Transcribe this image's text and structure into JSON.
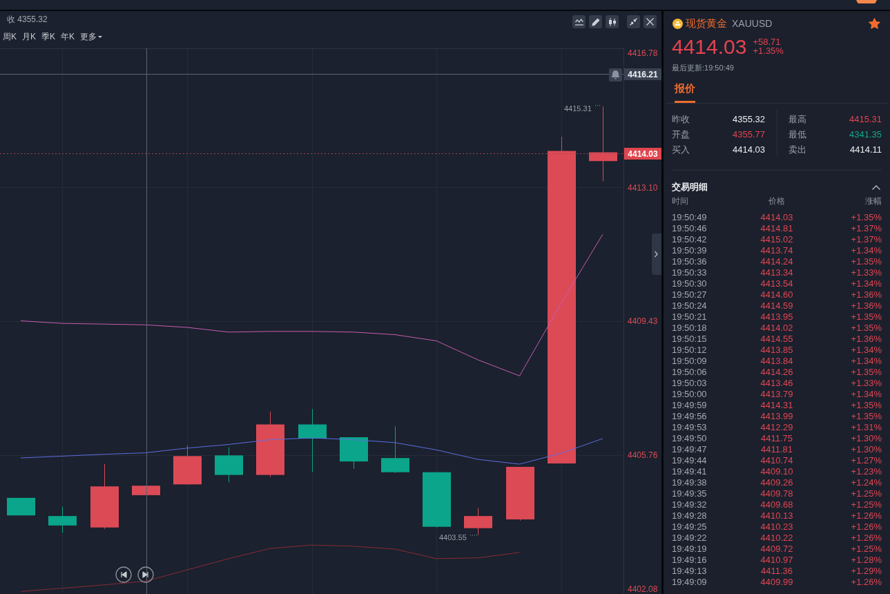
{
  "chart": {
    "previous_close": "收 4355.32",
    "periods": [
      {
        "label": "周K",
        "selected": false
      },
      {
        "label": "月K",
        "selected": false
      },
      {
        "label": "季K",
        "selected": false
      },
      {
        "label": "年K",
        "selected": false
      }
    ],
    "more": "更多",
    "crosshair_price": "4416.21",
    "last_price": "4414.03",
    "high_label": "4415.31",
    "low_label": "4403.55",
    "chart_data": {
      "type": "line",
      "grid": true,
      "categories": [
        null,
        null,
        null,
        null,
        null,
        null,
        null,
        null,
        null,
        null,
        null,
        null,
        null,
        null,
        null
      ],
      "ylim": [
        4401.95,
        4416.91
      ],
      "yticks": [
        4416.78,
        {
          "value": 4413.1,
          "label": "4413.10"
        },
        4409.43,
        4405.76,
        4402.08
      ],
      "ref_lines": [
        {
          "axis": "y",
          "value": 4416.21,
          "color": "#5d6372"
        },
        {
          "axis": "y",
          "value": 4414.03,
          "color": "#a8434e"
        }
      ],
      "series": [
        {
          "color": "#c95bb2",
          "values": [
            4409.44,
            4409.37,
            4409.35,
            4409.33,
            4409.26,
            4409.13,
            4409.15,
            4409.15,
            4409.13,
            4409.06,
            4408.89,
            4408.37,
            4407.93,
            4409.92,
            4411.81
          ]
        },
        {
          "color": "#5b6ee0",
          "values": [
            4405.68,
            4405.73,
            4405.78,
            4405.82,
            4405.95,
            4406.05,
            4406.18,
            4406.23,
            4406.18,
            4406.1,
            4405.9,
            4405.64,
            4405.51,
            4405.81,
            4406.21
          ]
        },
        {
          "color": "#8a2a36",
          "values": [
            4402.02,
            4402.11,
            4402.2,
            4402.3,
            4402.61,
            4402.92,
            4403.2,
            4403.29,
            4403.26,
            4403.18,
            4402.92,
            4402.94,
            4403.09,
            null,
            null
          ]
        }
      ]
    }
  },
  "quote": {
    "name": "现货黄金",
    "symbol": "XAUUSD",
    "favorite": true,
    "price": "4414.03",
    "change": "+58.71",
    "change_percent": "+1.35%",
    "updated": "最后更新:19:50:49",
    "tabs": [
      {
        "label": "报价",
        "selected": true
      }
    ],
    "stats": [
      {
        "label": "昨收",
        "value": "4355.32",
        "color": "#eceef1"
      },
      {
        "label": "最高",
        "value": "4415.31",
        "color": "#e5434f"
      },
      {
        "label": "开盘",
        "value": "4355.77",
        "color": "#e5434f"
      },
      {
        "label": "最低",
        "value": "4341.35",
        "color": "#13a88a"
      },
      {
        "label": "买入",
        "value": "4414.03",
        "color": "#eceef1"
      },
      {
        "label": "卖出",
        "value": "4414.11",
        "color": "#eceef1"
      }
    ]
  },
  "trades": {
    "title": "交易明细",
    "expanded": true,
    "columns": [
      "时间",
      "价格",
      "涨幅"
    ],
    "rows": [
      {
        "time": "19:50:49",
        "price": "4414.03",
        "change": "+1.35%"
      },
      {
        "time": "19:50:46",
        "price": "4414.81",
        "change": "+1.37%"
      },
      {
        "time": "19:50:42",
        "price": "4415.02",
        "change": "+1.37%"
      },
      {
        "time": "19:50:39",
        "price": "4413.74",
        "change": "+1.34%"
      },
      {
        "time": "19:50:36",
        "price": "4414.24",
        "change": "+1.35%"
      },
      {
        "time": "19:50:33",
        "price": "4413.34",
        "change": "+1.33%"
      },
      {
        "time": "19:50:30",
        "price": "4413.54",
        "change": "+1.34%"
      },
      {
        "time": "19:50:27",
        "price": "4414.60",
        "change": "+1.36%"
      },
      {
        "time": "19:50:24",
        "price": "4414.59",
        "change": "+1.36%"
      },
      {
        "time": "19:50:21",
        "price": "4413.95",
        "change": "+1.35%"
      },
      {
        "time": "19:50:18",
        "price": "4414.02",
        "change": "+1.35%"
      },
      {
        "time": "19:50:15",
        "price": "4414.55",
        "change": "+1.36%"
      },
      {
        "time": "19:50:12",
        "price": "4413.85",
        "change": "+1.34%"
      },
      {
        "time": "19:50:09",
        "price": "4413.84",
        "change": "+1.34%"
      },
      {
        "time": "19:50:06",
        "price": "4414.26",
        "change": "+1.35%"
      },
      {
        "time": "19:50:03",
        "price": "4413.46",
        "change": "+1.33%"
      },
      {
        "time": "19:50:00",
        "price": "4413.79",
        "change": "+1.34%"
      },
      {
        "time": "19:49:59",
        "price": "4414.31",
        "change": "+1.35%"
      },
      {
        "time": "19:49:56",
        "price": "4413.99",
        "change": "+1.35%"
      },
      {
        "time": "19:49:53",
        "price": "4412.29",
        "change": "+1.31%"
      },
      {
        "time": "19:49:50",
        "price": "4411.75",
        "change": "+1.30%"
      },
      {
        "time": "19:49:47",
        "price": "4411.81",
        "change": "+1.30%"
      },
      {
        "time": "19:49:44",
        "price": "4410.74",
        "change": "+1.27%"
      },
      {
        "time": "19:49:41",
        "price": "4409.10",
        "change": "+1.23%"
      },
      {
        "time": "19:49:38",
        "price": "4409.26",
        "change": "+1.24%"
      },
      {
        "time": "19:49:35",
        "price": "4409.78",
        "change": "+1.25%"
      },
      {
        "time": "19:49:32",
        "price": "4409.68",
        "change": "+1.25%"
      },
      {
        "time": "19:49:28",
        "price": "4410.13",
        "change": "+1.26%"
      },
      {
        "time": "19:49:25",
        "price": "4410.23",
        "change": "+1.26%"
      },
      {
        "time": "19:49:22",
        "price": "4410.22",
        "change": "+1.26%"
      },
      {
        "time": "19:49:19",
        "price": "4409.72",
        "change": "+1.25%"
      },
      {
        "time": "19:49:16",
        "price": "4410.97",
        "change": "+1.28%"
      },
      {
        "time": "19:49:13",
        "price": "4411.36",
        "change": "+1.29%"
      },
      {
        "time": "19:49:09",
        "price": "4409.99",
        "change": "+1.26%"
      }
    ]
  }
}
